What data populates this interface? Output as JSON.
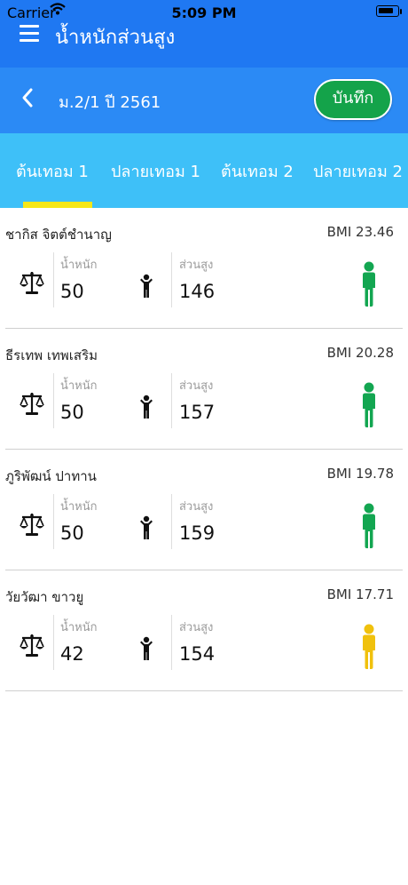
{
  "status": {
    "carrier": "Carrier",
    "time": "5:09 PM"
  },
  "app_bar": {
    "title": "น้ำหนักส่วนสูง"
  },
  "class_bar": {
    "label": "ม.2/1 ปี 2561",
    "save_label": "บันทึก"
  },
  "tabs": [
    {
      "label": "ต้นเทอม 1",
      "selected": true
    },
    {
      "label": "ปลายเทอม 1",
      "selected": false
    },
    {
      "label": "ต้นเทอม 2",
      "selected": false
    },
    {
      "label": "ปลายเทอม 2",
      "selected": false
    }
  ],
  "field_labels": {
    "weight": "น้ำหนัก",
    "height": "ส่วนสูง"
  },
  "students": [
    {
      "name": "ชากิส จิตต์ชำนาญ",
      "bmi": "BMI 23.46",
      "weight": "50",
      "height": "146",
      "status_color": "#13a651"
    },
    {
      "name": "ธีรเทพ เทพเสริม",
      "bmi": "BMI 20.28",
      "weight": "50",
      "height": "157",
      "status_color": "#13a651"
    },
    {
      "name": "ภูริพัฒน์ ปาทาน",
      "bmi": "BMI 19.78",
      "weight": "50",
      "height": "159",
      "status_color": "#13a651"
    },
    {
      "name": "วัยวัฒา ขาวยู",
      "bmi": "BMI 17.71",
      "weight": "42",
      "height": "154",
      "status_color": "#f0c10d"
    }
  ],
  "colors": {
    "header": "#1f78f2",
    "tabs": "#3ec0f8",
    "save": "#14a34a",
    "indicator": "#f6e719"
  },
  "icons": {
    "menu": "hamburger-icon",
    "back": "chevron-left-icon",
    "weight": "scale-icon",
    "height": "child-icon",
    "status": "person-icon"
  }
}
